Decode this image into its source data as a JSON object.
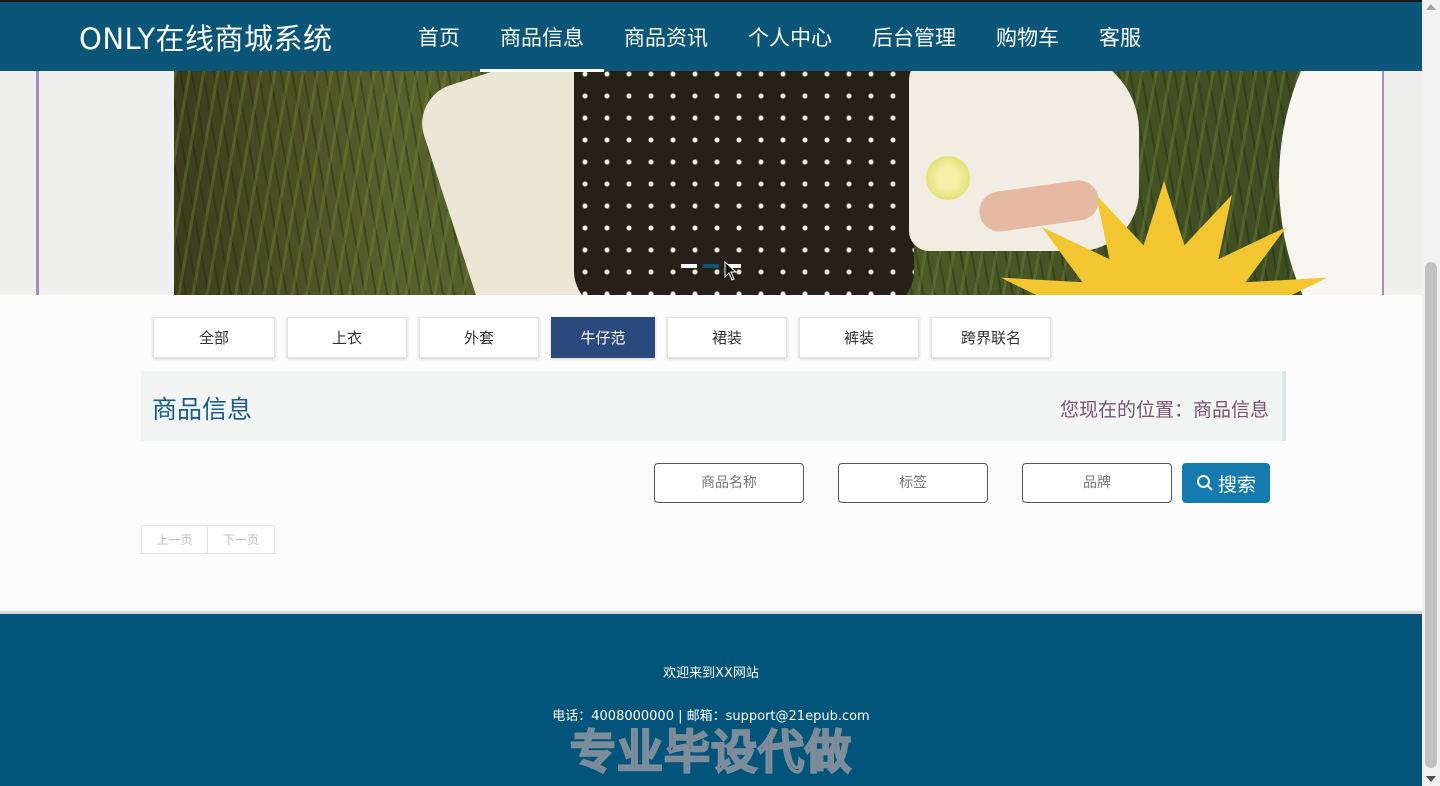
{
  "header": {
    "brand": "ONLY在线商城系统",
    "nav": [
      {
        "label": "首页"
      },
      {
        "label": "商品信息"
      },
      {
        "label": "商品资讯"
      },
      {
        "label": "个人中心"
      },
      {
        "label": "后台管理"
      },
      {
        "label": "购物车"
      },
      {
        "label": "客服"
      }
    ],
    "active_nav": "商品信息"
  },
  "banner": {
    "slide_count": 3,
    "active_slide": 2
  },
  "categories": {
    "tabs": [
      "全部",
      "上衣",
      "外套",
      "牛仔范",
      "裙装",
      "裤装",
      "跨界联名"
    ],
    "active": "牛仔范"
  },
  "section": {
    "title": "商品信息",
    "location": "您现在的位置：商品信息"
  },
  "filters": {
    "name_placeholder": "商品名称",
    "tag_placeholder": "标签",
    "brand_placeholder": "品牌",
    "search_label": "搜索"
  },
  "pager": {
    "prev": "上一页",
    "next": "下一页"
  },
  "footer": {
    "welcome": "欢迎来到XX网站",
    "contact": "电话：4008000000 | 邮箱：support@21epub.com",
    "watermark": "专业毕设代做"
  },
  "colors": {
    "header_bg": "#0a5578",
    "active_tab": "#2a4a7e",
    "search_button": "#157aad",
    "footer_bg": "#02547a"
  }
}
